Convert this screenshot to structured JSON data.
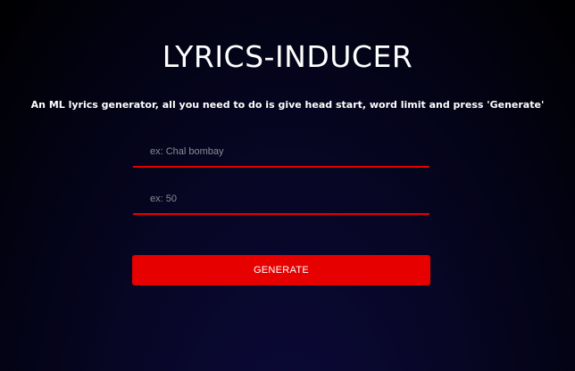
{
  "header": {
    "title": "LYRICS-INDUCER",
    "subtitle": "An ML lyrics generator, all you need to do is give head start, word limit and press 'Generate'"
  },
  "form": {
    "head_start": {
      "value": "",
      "placeholder": "ex: Chal bombay"
    },
    "word_limit": {
      "value": "",
      "placeholder": "ex: 50"
    },
    "generate_label": "GENERATE"
  },
  "colors": {
    "accent": "#e60000",
    "background": "#02020f",
    "text": "#ffffff",
    "placeholder": "#8a8a95"
  }
}
